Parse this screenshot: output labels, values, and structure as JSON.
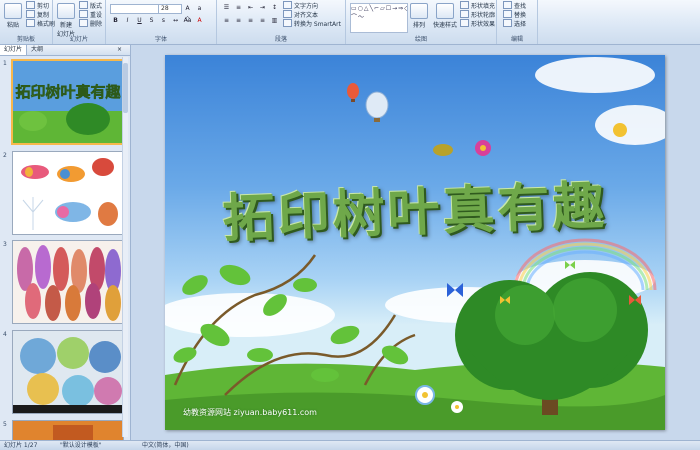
{
  "ribbon": {
    "clipboard": {
      "group_label": "剪贴板",
      "paste": "粘贴",
      "cut": "剪切",
      "copy": "复制",
      "format_painter": "格式刷"
    },
    "slides": {
      "group_label": "幻灯片",
      "new_slide": "新建",
      "new_slide_2": "幻灯片",
      "layout": "版式",
      "reset": "重设",
      "delete": "删除"
    },
    "font": {
      "group_label": "字体",
      "font_size": "28"
    },
    "paragraph": {
      "group_label": "段落",
      "text_direction": "文字方向",
      "align_text": "对齐文本",
      "smartart": "转换为 SmartArt"
    },
    "drawing": {
      "group_label": "绘图",
      "arrange": "排列",
      "quick_styles": "快速样式",
      "shape_fill": "形状填充",
      "shape_outline": "形状轮廓",
      "shape_effects": "形状效果"
    },
    "editing": {
      "group_label": "编辑",
      "find": "查找",
      "replace": "替换",
      "select": "选择"
    }
  },
  "left_panel": {
    "tab_slides": "幻灯片",
    "tab_outline": "大纲",
    "close": "×",
    "thumb_numbers": [
      "1",
      "2",
      "3",
      "4",
      "5"
    ]
  },
  "slide": {
    "title": "拓印树叶真有趣",
    "watermark": "幼教资源网站  ziyuan.baby611.com"
  },
  "status_bar": {
    "slide_info": "幻灯片 1/27",
    "theme": "\"默认设计模板\"",
    "language": "中文(简体，中国)"
  },
  "colors": {
    "ribbon_bg": "#dbe7f5",
    "sky": "#6aa9e8",
    "grass": "#5fb636",
    "title_green": "#6fa84a",
    "selection": "#f7b84b"
  }
}
